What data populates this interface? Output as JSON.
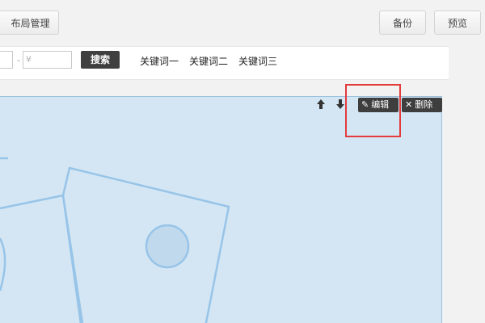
{
  "toolbar": {
    "layout_manage_label": "布局管理",
    "backup_label": "备份",
    "preview_label": "预览"
  },
  "search": {
    "min_price_placeholder": "",
    "max_price_placeholder": "¥",
    "range_dash": "-",
    "search_label": "搜索",
    "keywords": [
      "关键词一",
      "关键词二",
      "关键词三"
    ]
  },
  "module_actions": {
    "edit_label": "编辑",
    "delete_label": "删除",
    "icons": [
      "arrow-up-icon",
      "arrow-down-icon",
      "pencil-icon",
      "close-icon"
    ]
  },
  "colors": {
    "panel_bg": "#d4e6f3",
    "shape_stroke": "#97c4e8",
    "highlight": "#e33b3b",
    "action_bg": "#3e3e3e"
  }
}
